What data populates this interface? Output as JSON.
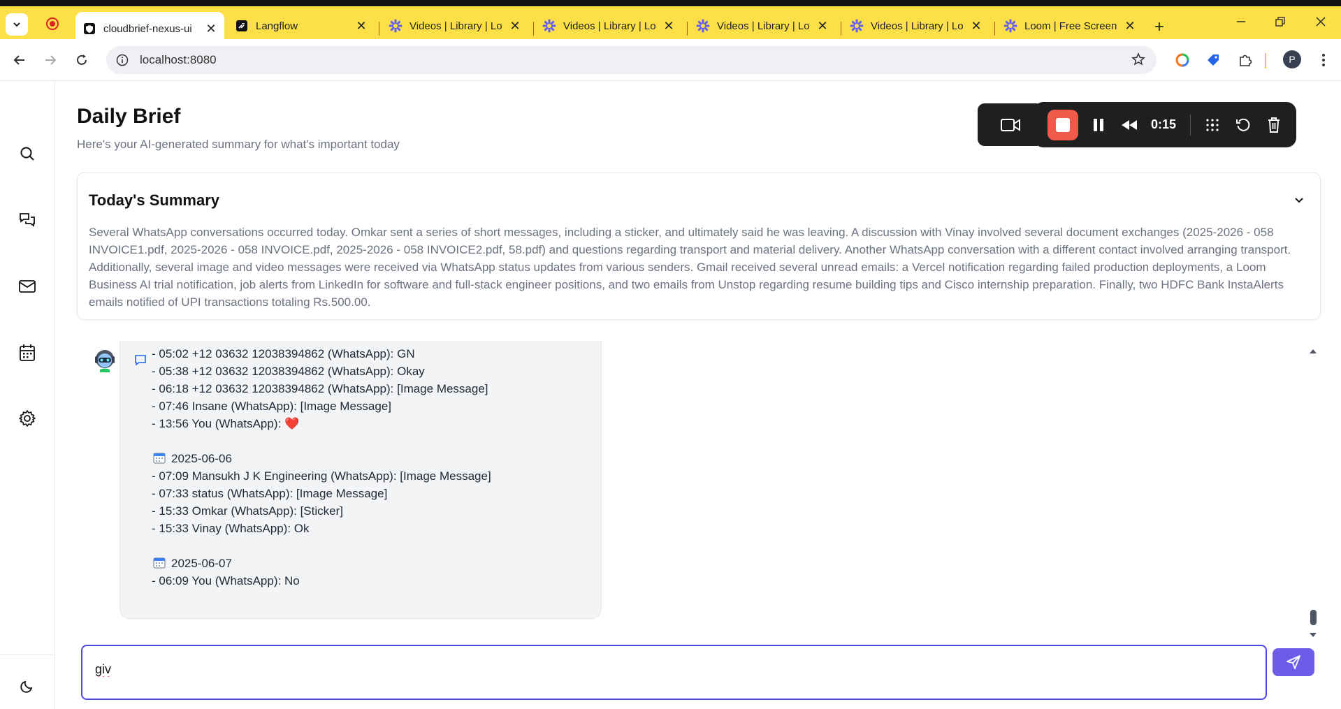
{
  "browser": {
    "tabs": [
      {
        "title": "cloudbrief-nexus-ui",
        "active": true,
        "favicon": "shield-icon"
      },
      {
        "title": "Langflow",
        "active": false,
        "favicon": "langflow-icon"
      },
      {
        "title": "Videos | Library | Lo",
        "active": false,
        "favicon": "loom-icon"
      },
      {
        "title": "Videos | Library | Lo",
        "active": false,
        "favicon": "loom-icon"
      },
      {
        "title": "Videos | Library | Lo",
        "active": false,
        "favicon": "loom-icon"
      },
      {
        "title": "Videos | Library | Lo",
        "active": false,
        "favicon": "loom-icon"
      },
      {
        "title": "Loom | Free Screen",
        "active": false,
        "favicon": "loom-icon"
      }
    ],
    "url": "localhost:8080",
    "profile_initial": "P",
    "tabbar_color": "#fde047"
  },
  "header": {
    "title": "Daily Brief",
    "subtitle": "Here's your AI-generated summary for what's important today"
  },
  "recorder": {
    "time": "0:15",
    "stop_color": "#f05a4a"
  },
  "summary": {
    "title": "Today's Summary",
    "body": "Several WhatsApp conversations occurred today. Omkar sent a series of short messages, including a sticker, and ultimately said he was leaving. A discussion with Vinay involved several document exchanges (2025-2026 - 058 INVOICE1.pdf, 2025-2026 - 058 INVOICE.pdf, 2025-2026 - 058 INVOICE2.pdf, 58.pdf) and questions regarding transport and material delivery. Another WhatsApp conversation with a different contact involved arranging transport. Additionally, several image and video messages were received via WhatsApp status updates from various senders. Gmail received several unread emails: a Vercel notification regarding failed production deployments, a Loom Business AI trial notification, job alerts from LinkedIn for software and full-stack engineer positions, and two emails from Unstop regarding resume building tips and Cisco internship preparation. Finally, two HDFC Bank InstaAlerts emails notified of UPI transactions totaling Rs.500.00."
  },
  "chat": {
    "lines": [
      "- 05:02 +12 03632 12038394862 (WhatsApp): GN",
      "- 05:38 +12 03632 12038394862 (WhatsApp): Okay",
      "- 06:18 +12 03632 12038394862 (WhatsApp): [Image Message]",
      "- 07:46 Insane (WhatsApp): [Image Message]",
      "- 13:56 You (WhatsApp): ",
      "",
      "2025-06-06",
      "- 07:09 Mansukh J K Engineering (WhatsApp): [Image Message]",
      "- 07:33 status (WhatsApp): [Image Message]",
      "- 15:33 Omkar (WhatsApp): [Sticker]",
      "- 15:33 Vinay (WhatsApp): Ok",
      "",
      "2025-06-07",
      "- 06:09 You (WhatsApp): No"
    ],
    "heart": "❤️"
  },
  "composer": {
    "value": "giv",
    "accent": "#4f46e5",
    "send_color": "#6d5ce8"
  }
}
